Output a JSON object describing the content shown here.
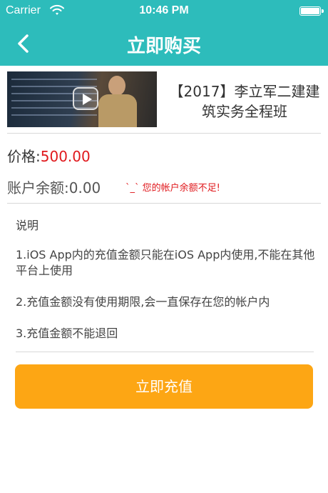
{
  "status_bar": {
    "carrier": "Carrier",
    "time": "10:46 PM"
  },
  "nav": {
    "title": "立即购买",
    "back_icon": "chevron-left-icon"
  },
  "course": {
    "title": "【2017】李立军二建建筑实务全程班",
    "thumbnail_icon": "video-thumbnail",
    "play_icon": "play-icon"
  },
  "price": {
    "label": "价格:",
    "value": "500.00"
  },
  "balance": {
    "label": "账户余额:",
    "value": "0.00",
    "warning": "`_` 您的帐户余额不足!"
  },
  "description": {
    "title": "说明",
    "notes": [
      "1.iOS App内的充值金额只能在iOS App内使用,不能在其他平台上使用",
      "2.充值金额没有使用期限,会一直保存在您的帐户内",
      "3.充值金额不能退回"
    ]
  },
  "action": {
    "recharge_label": "立即充值"
  },
  "colors": {
    "accent": "#2dbcbb",
    "price": "#e0191d",
    "button": "#fda614"
  }
}
